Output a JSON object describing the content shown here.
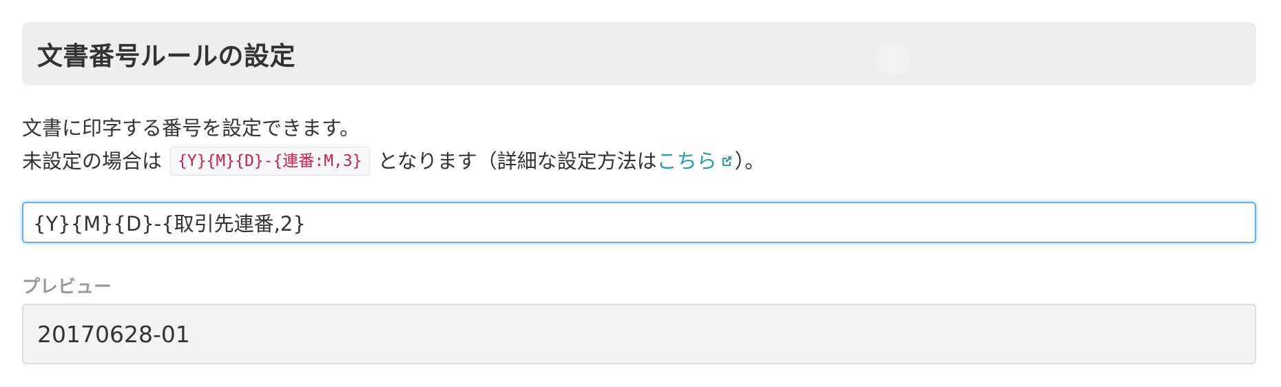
{
  "settings": {
    "title": "文書番号ルールの設定",
    "description_line1": "文書に印字する番号を設定できます。",
    "description_line2_prefix": "未設定の場合は",
    "default_rule_code": "{Y}{M}{D}-{連番:M,3}",
    "description_line2_middle": "となります（詳細な設定方法は",
    "help_link_label": "こちら",
    "help_link_icon": "external-link-icon",
    "description_line2_suffix": "）。",
    "rule_input_value": "{Y}{M}{D}-{取引先連番,2}",
    "preview_label": "プレビュー",
    "preview_value": "20170628-01"
  },
  "colors": {
    "link": "#2a9ab0",
    "code_text": "#c7254e",
    "input_focus_border": "#66afe9",
    "heading_background": "#eeeeee",
    "preview_background": "#f3f3f3",
    "muted_label": "#999999"
  }
}
